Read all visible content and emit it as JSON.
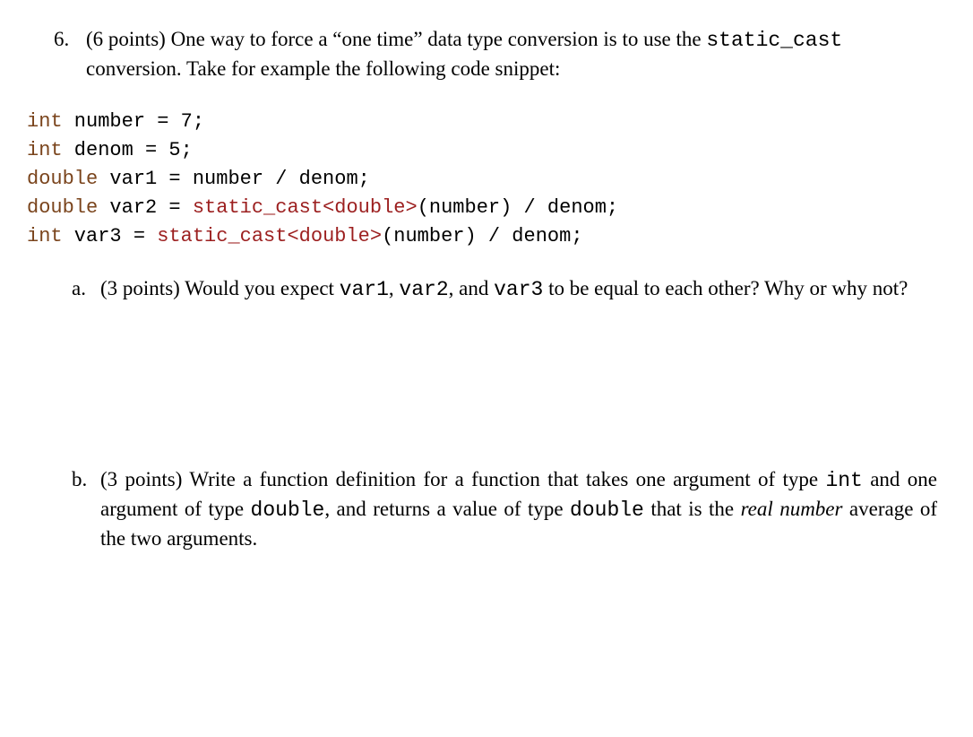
{
  "question": {
    "number": "6.",
    "points": "(6 points)",
    "text_before_code": "One way to force a “one time” data type conversion is to use the ",
    "code_inline": "static_cast",
    "text_after_code": " conversion.  Take for example the following code snippet:"
  },
  "code": {
    "l1_kw": "int",
    "l1_rest": " number = 7;",
    "l2_kw": "int",
    "l2_rest": " denom = 5;",
    "l3_kw": "double",
    "l3_rest1": " var1 = number / denom;",
    "l4_kw": "double",
    "l4_rest1": " var2 = ",
    "l4_fn": "static_cast<double>",
    "l4_rest2": "(number) / denom;",
    "l5_kw": "int",
    "l5_rest1": " var3 = ",
    "l5_fn": "static_cast<double>",
    "l5_rest2": "(number) / denom;"
  },
  "sub_a": {
    "label": "a.",
    "points": "(3 points)",
    "text1": "Would you expect ",
    "v1": "var1",
    "sep1": ", ",
    "v2": "var2",
    "sep2": ", and ",
    "v3": "var3",
    "text2": " to be equal to each other?  Why or why not?"
  },
  "sub_b": {
    "label": "b.",
    "points": "(3 points)",
    "text1": "Write a function definition for a function that takes one argument of type ",
    "c1": "int",
    "text2": " and one argument of type ",
    "c2": "double",
    "text3": ", and returns a value of type ",
    "c3": "double",
    "text4": " that is the ",
    "italic": "real number",
    "text5": " average of the two arguments."
  }
}
